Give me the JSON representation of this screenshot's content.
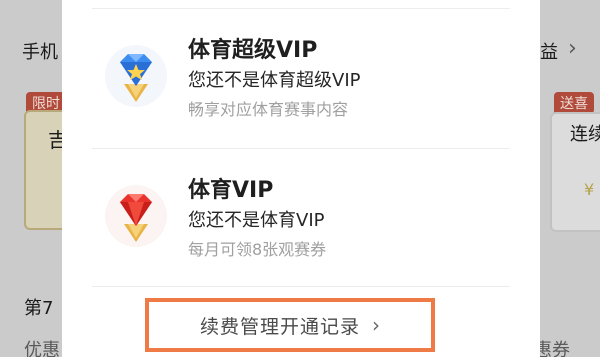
{
  "background": {
    "left": {
      "top_label": "手机",
      "badge": "限时",
      "card_glyph": "吉",
      "section_label": "第7",
      "bottom_label": "优惠"
    },
    "right": {
      "top_label": "益",
      "chevron": "›",
      "badge": "送喜",
      "card_label": "连续",
      "price_glyph": "¥",
      "bottom_label": "惠券"
    }
  },
  "tiers": [
    {
      "title": "体育超级VIP",
      "status": "您还不是体育超级VIP",
      "description": "畅享对应体育赛事内容",
      "icon": "blue-diamond-trophy-icon"
    },
    {
      "title": "体育VIP",
      "status": "您还不是体育VIP",
      "description": "每月可领8张观赛券",
      "icon": "red-diamond-trophy-icon"
    }
  ],
  "records_button": {
    "label": "续费管理开通记录",
    "chevron": "›"
  },
  "colors": {
    "highlight_border": "#ee7a45",
    "gold": "#e8b447",
    "blue_gem": "#3d8cf0",
    "red_gem": "#e8322b"
  }
}
